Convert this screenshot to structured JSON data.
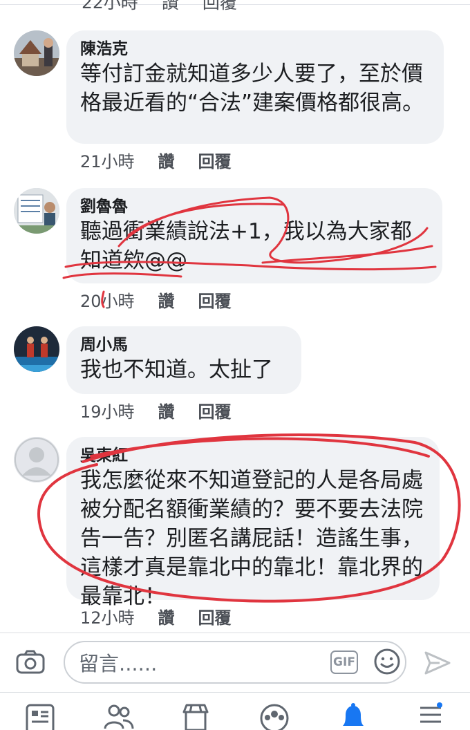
{
  "partial_comment": {
    "time": "22小時",
    "like_label": "讚",
    "reply_label": "回覆"
  },
  "comments": [
    {
      "author": "陳浩克",
      "text": "等付訂金就知道多少人要了，至於價格最近看的“合法”建案價格都很高。",
      "time": "21小時",
      "like_label": "讚",
      "reply_label": "回覆"
    },
    {
      "author": "劉魯魯",
      "text": "聽過衝業績說法+1，我以為大家都知道欸@@",
      "time": "20小時",
      "like_label": "讚",
      "reply_label": "回覆"
    },
    {
      "author": "周小馬",
      "text": "我也不知道。太扯了",
      "time": "19小時",
      "like_label": "讚",
      "reply_label": "回覆"
    },
    {
      "author": "吳東紅",
      "text": "我怎麼從來不知道登記的人是各局處被分配名額衝業績的？要不要去法院告一告？別匿名講屁話！造謠生事，這樣才真是靠北中的靠北！靠北界的最靠北！",
      "time": "12小時",
      "like_label": "讚",
      "reply_label": "回覆"
    }
  ],
  "composer": {
    "placeholder": "留言......",
    "gif_label": "GIF"
  },
  "icons": {
    "camera": "camera-icon",
    "emoji": "emoji-icon",
    "send": "send-icon",
    "tabs": [
      "news-feed-icon",
      "friends-icon",
      "marketplace-icon",
      "groups-icon",
      "notifications-icon",
      "menu-icon"
    ]
  },
  "colors": {
    "accent": "#1877f2",
    "bubble": "#f0f2f5",
    "annotation": "#e0353f",
    "meta": "#4b4f56"
  }
}
